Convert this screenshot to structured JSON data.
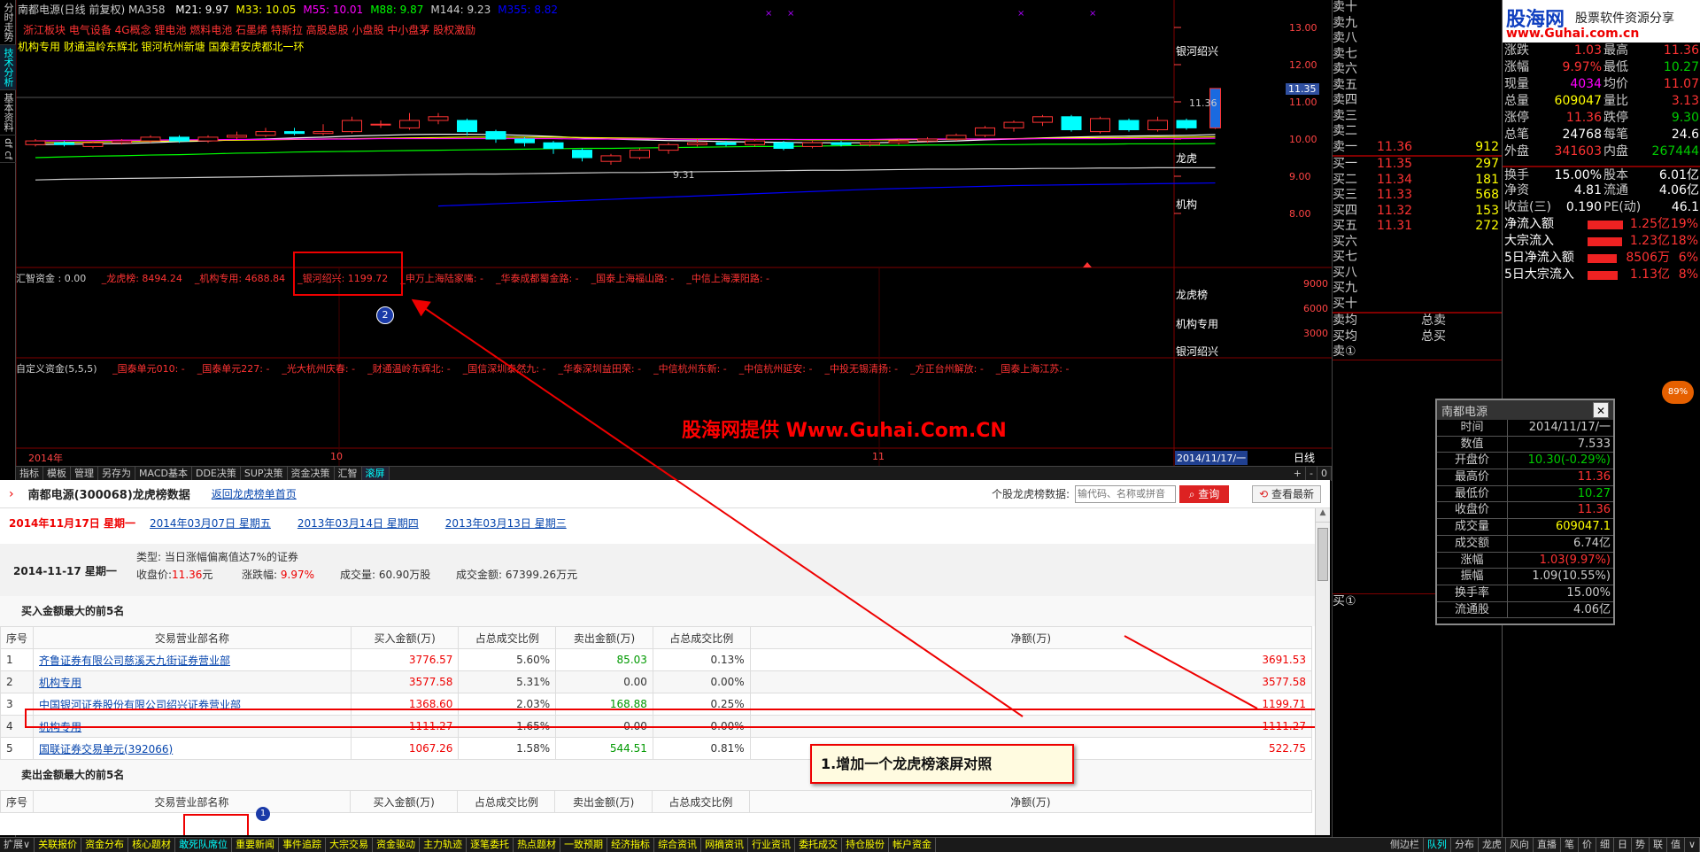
{
  "leftbar": {
    "items": [
      "分时走势",
      "技术分析",
      "基本资料",
      "df cf"
    ]
  },
  "chart": {
    "title": "南都电源(日线 前复权) MA358",
    "ma": [
      {
        "label": "M21: 9.97",
        "color": "#fff"
      },
      {
        "label": "M33: 10.05",
        "color": "#ff0"
      },
      {
        "label": "M55: 10.01",
        "color": "#f0f"
      },
      {
        "label": "M88: 9.87",
        "color": "#0f0"
      },
      {
        "label": "M144: 9.23",
        "color": "#ccc"
      },
      {
        "label": "M355: 8.82",
        "color": "#00f"
      }
    ],
    "concepts1": "浙江板块 电气设备 4G概念 锂电池 燃料电池 石墨烯 特斯拉 高股息股 小盘股 中小盘茅 股权激励",
    "concepts2": "机构专用 财通温岭东辉北 银河杭州新塘 国泰君安虎都北一环",
    "price_ticks": [
      "13.00",
      "12.00",
      "11.00",
      "10.00",
      "9.00",
      "8.00"
    ],
    "last_price": "11.35",
    "high_label": "11.36",
    "low_label": "9.31",
    "side_labels": [
      "银河绍兴",
      "龙虎",
      "机构"
    ],
    "fund_row": {
      "label": "汇智资金 : 0.00",
      "items": [
        "_龙虎榜: 8494.24",
        "_机构专用: 4688.84",
        "_银河绍兴: 1199.72",
        "_申万上海陆家嘴: -",
        "_华泰成都蜀金路: -",
        "_国泰上海福山路: -",
        "_中信上海溧阳路: -"
      ]
    },
    "fund_ticks": [
      "9000",
      "6000",
      "3000"
    ],
    "fund_side": [
      "龙虎榜",
      "机构专用",
      "银河绍兴"
    ],
    "custom_row": {
      "label": "自定义资金(5,5,5)",
      "items": [
        "_国泰单元010: -",
        "_国泰单元227: -",
        "_光大杭州庆春: -",
        "_财通温岭东辉北: -",
        "_国信深圳泰然九: -",
        "_华泰深圳益田荣: -",
        "_中信杭州东新: -",
        "_中信杭州延安: -",
        "_中投无锡清扬: -",
        "_方正台州解放: -",
        "_国泰上海江苏: -"
      ]
    },
    "x_labels": [
      "2014年",
      "10",
      "11"
    ],
    "date_box": "2014/11/17/一",
    "period": "日线",
    "badge2": "2",
    "watermark": "股海网提供 Www.Guhai.Com.CN"
  },
  "bottom_tabs": [
    "指标",
    "模板",
    "管理",
    "另存为",
    "MACD基本",
    "DDE决策",
    "SUP决策",
    "资金决策",
    "汇智",
    "滚屏"
  ],
  "bottom_right": [
    "+",
    "-",
    "0"
  ],
  "panel": {
    "title": "南都电源(300068)龙虎榜数据",
    "back_link": "返回龙虎榜单首页",
    "search_label": "个股龙虎榜数据:",
    "search_placeholder": "输代码、名称或拼音",
    "query_btn": "查询",
    "latest_btn": "查看最新",
    "dates": [
      {
        "t": "2014年11月17日  星期一",
        "active": true
      },
      {
        "t": "2014年03月07日  星期五",
        "active": false
      },
      {
        "t": "2013年03月14日  星期四",
        "active": false
      },
      {
        "t": "2013年03月13日  星期三",
        "active": false
      }
    ],
    "day": "2014-11-17  星期一",
    "type": "类型:  当日涨幅偏离值达7%的证券",
    "close_label": "收盘价:",
    "close_val": "11.36",
    "close_unit": "元",
    "chg_label": "涨跌幅:",
    "chg_val": "9.97%",
    "vol": "成交量:  60.90万股",
    "amt": "成交金额:  67399.26万元",
    "buy_title": "买入金额最大的前5名",
    "sell_title": "卖出金额最大的前5名",
    "headers": [
      "序号",
      "交易营业部名称",
      "买入金额(万)",
      "占总成交比例",
      "卖出金额(万)",
      "占总成交比例",
      "净额(万)"
    ],
    "rows": [
      [
        "1",
        "齐鲁证券有限公司慈溪天九街证券营业部",
        "3776.57",
        "5.60%",
        "85.03",
        "0.13%",
        "3691.53"
      ],
      [
        "2",
        "机构专用",
        "3577.58",
        "5.31%",
        "0.00",
        "0.00%",
        "3577.58"
      ],
      [
        "3",
        "中国银河证券股份有限公司绍兴证券营业部",
        "1368.60",
        "2.03%",
        "168.88",
        "0.25%",
        "1199.71"
      ],
      [
        "4",
        "机构专用",
        "1111.27",
        "1.65%",
        "0.00",
        "0.00%",
        "1111.27"
      ],
      [
        "5",
        "国联证券交易单元(392066)",
        "1067.26",
        "1.58%",
        "544.51",
        "0.81%",
        "522.75"
      ]
    ],
    "annotation": "1.增加一个龙虎榜滚屏对照",
    "badge1": "1"
  },
  "quote": {
    "sell": [
      {
        "l": "卖十"
      },
      {
        "l": "卖九"
      },
      {
        "l": "卖八"
      },
      {
        "l": "卖七"
      },
      {
        "l": "卖六"
      },
      {
        "l": "卖五"
      },
      {
        "l": "卖四"
      },
      {
        "l": "卖三"
      },
      {
        "l": "卖二"
      },
      {
        "l": "卖一",
        "p": "11.36",
        "v": "912"
      }
    ],
    "buy": [
      {
        "l": "买一",
        "p": "11.35",
        "v": "297"
      },
      {
        "l": "买二",
        "p": "11.34",
        "v": "181"
      },
      {
        "l": "买三",
        "p": "11.33",
        "v": "568"
      },
      {
        "l": "买四",
        "p": "11.32",
        "v": "153"
      },
      {
        "l": "买五",
        "p": "11.31",
        "v": "272"
      },
      {
        "l": "买六"
      },
      {
        "l": "买七"
      },
      {
        "l": "买八"
      },
      {
        "l": "买九"
      },
      {
        "l": "买十"
      }
    ],
    "ext": [
      {
        "a": "卖均",
        "b": "总卖"
      },
      {
        "a": "买均",
        "b": "总买"
      }
    ],
    "sell_circle": "卖①",
    "buy_circle": "买①"
  },
  "stats": {
    "brand": "股海网",
    "brand_sub": "股票软件资源分享",
    "brand_url": "www.Guhai.com.cn",
    "rows": [
      [
        {
          "t": "涨跌",
          "c": "#ccc"
        },
        {
          "t": "1.03",
          "c": "#f33"
        },
        {
          "t": "最高",
          "c": "#ccc"
        },
        {
          "t": "11.36",
          "c": "#f33"
        }
      ],
      [
        {
          "t": "涨幅",
          "c": "#ccc"
        },
        {
          "t": "9.97%",
          "c": "#f33"
        },
        {
          "t": "最低",
          "c": "#ccc"
        },
        {
          "t": "10.27",
          "c": "#0c0"
        }
      ],
      [
        {
          "t": "现量",
          "c": "#ccc"
        },
        {
          "t": "4034",
          "c": "#f0f"
        },
        {
          "t": "均价",
          "c": "#ccc"
        },
        {
          "t": "11.07",
          "c": "#f33"
        }
      ],
      [
        {
          "t": "总量",
          "c": "#ccc"
        },
        {
          "t": "609047",
          "c": "#ff0"
        },
        {
          "t": "量比",
          "c": "#ccc"
        },
        {
          "t": "3.13",
          "c": "#f33"
        }
      ],
      [
        {
          "t": "涨停",
          "c": "#ccc"
        },
        {
          "t": "11.36",
          "c": "#f33"
        },
        {
          "t": "跌停",
          "c": "#ccc"
        },
        {
          "t": "9.30",
          "c": "#0c0"
        }
      ],
      [
        {
          "t": "总笔",
          "c": "#ccc"
        },
        {
          "t": "24768",
          "c": "#fff"
        },
        {
          "t": "每笔",
          "c": "#ccc"
        },
        {
          "t": "24.6",
          "c": "#fff"
        }
      ],
      [
        {
          "t": "外盘",
          "c": "#ccc"
        },
        {
          "t": "341603",
          "c": "#f33"
        },
        {
          "t": "内盘",
          "c": "#ccc"
        },
        {
          "t": "267444",
          "c": "#0c0"
        }
      ],
      [
        {
          "t": "换手",
          "c": "#ccc"
        },
        {
          "t": "15.00%",
          "c": "#fff"
        },
        {
          "t": "股本",
          "c": "#ccc"
        },
        {
          "t": "6.01亿",
          "c": "#fff"
        }
      ],
      [
        {
          "t": "净资",
          "c": "#ccc"
        },
        {
          "t": "4.81",
          "c": "#fff"
        },
        {
          "t": "流通",
          "c": "#ccc"
        },
        {
          "t": "4.06亿",
          "c": "#fff"
        }
      ],
      [
        {
          "t": "收益(三)",
          "c": "#ccc"
        },
        {
          "t": "0.190",
          "c": "#fff"
        },
        {
          "t": "PE(动)",
          "c": "#ccc"
        },
        {
          "t": "46.1",
          "c": "#fff"
        }
      ]
    ],
    "flows": [
      {
        "l": "净流入额",
        "v": "1.25亿",
        "p": "19%",
        "f": 0.19
      },
      {
        "l": "大宗流入",
        "v": "1.23亿",
        "p": "18%",
        "f": 0.18
      },
      {
        "l": "5日净流入额",
        "v": "8506万",
        "p": "6%",
        "f": 0.06
      },
      {
        "l": "5日大宗流入",
        "v": "1.13亿",
        "p": "8%",
        "f": 0.08
      }
    ],
    "pct_badge": "89%"
  },
  "popup": {
    "title": "南都电源",
    "rows": [
      {
        "k": "时间",
        "v": "2014/11/17/一",
        "c": "#ccc"
      },
      {
        "k": "数值",
        "v": "7.533",
        "c": "#ccc"
      },
      {
        "k": "开盘价",
        "v": "10.30(-0.29%)",
        "c": "#0c0"
      },
      {
        "k": "最高价",
        "v": "11.36",
        "c": "#f33"
      },
      {
        "k": "最低价",
        "v": "10.27",
        "c": "#0c0"
      },
      {
        "k": "收盘价",
        "v": "11.36",
        "c": "#f33"
      },
      {
        "k": "成交量",
        "v": "609047.1",
        "c": "#ff0"
      },
      {
        "k": "成交额",
        "v": "6.74亿",
        "c": "#ccc"
      },
      {
        "k": "涨幅",
        "v": "1.03(9.97%)",
        "c": "#f33"
      },
      {
        "k": "振幅",
        "v": "1.09(10.55%)",
        "c": "#ccc"
      },
      {
        "k": "换手率",
        "v": "15.00%",
        "c": "#ccc"
      },
      {
        "k": "流通股",
        "v": "4.06亿",
        "c": "#ccc"
      }
    ]
  },
  "statusbar": {
    "left": [
      "扩展∨",
      "关联报价",
      "资金分布",
      "核心题材",
      "敢死队席位",
      "重要新闻",
      "事件追踪",
      "大宗交易",
      "资金驱动",
      "主力轨迹",
      "逐笔委托",
      "热点题材",
      "一致预期",
      "经济指标",
      "综合资讯",
      "网摘资讯",
      "行业资讯",
      "委托成交",
      "持仓股份",
      "帐户资金"
    ],
    "right": [
      "侧边栏",
      "队列",
      "分布",
      "龙虎",
      "风向",
      "直播",
      "笔",
      "价",
      "细",
      "日",
      "势",
      "联",
      "值",
      "∨"
    ]
  },
  "chart_data": {
    "type": "candlestick",
    "title": "南都电源(日线 前复权) MA358",
    "ylim": [
      7.5,
      13.5
    ],
    "candles": [
      {
        "o": 9.85,
        "c": 9.95,
        "h": 10.0,
        "l": 9.8
      },
      {
        "o": 9.9,
        "c": 9.85,
        "h": 9.95,
        "l": 9.8
      },
      {
        "o": 9.8,
        "c": 9.9,
        "h": 9.95,
        "l": 9.75
      },
      {
        "o": 9.9,
        "c": 9.95,
        "h": 10.0,
        "l": 9.85
      },
      {
        "o": 9.95,
        "c": 10.05,
        "h": 10.1,
        "l": 9.9
      },
      {
        "o": 10.05,
        "c": 9.95,
        "h": 10.1,
        "l": 9.9
      },
      {
        "o": 9.95,
        "c": 10.05,
        "h": 10.1,
        "l": 9.9
      },
      {
        "o": 10.05,
        "c": 10.1,
        "h": 10.2,
        "l": 10.0
      },
      {
        "o": 10.1,
        "c": 10.2,
        "h": 10.3,
        "l": 10.05
      },
      {
        "o": 10.2,
        "c": 10.15,
        "h": 10.3,
        "l": 10.1
      },
      {
        "o": 10.15,
        "c": 10.2,
        "h": 10.4,
        "l": 10.1
      },
      {
        "o": 10.2,
        "c": 10.5,
        "h": 10.6,
        "l": 10.15
      },
      {
        "o": 10.4,
        "c": 10.4,
        "h": 10.5,
        "l": 10.3
      },
      {
        "o": 10.3,
        "c": 10.5,
        "h": 10.7,
        "l": 10.25
      },
      {
        "o": 10.5,
        "c": 10.6,
        "h": 10.7,
        "l": 10.4
      },
      {
        "o": 10.5,
        "c": 10.2,
        "h": 10.55,
        "l": 10.1
      },
      {
        "o": 10.2,
        "c": 10.0,
        "h": 10.25,
        "l": 9.9
      },
      {
        "o": 10.0,
        "c": 9.9,
        "h": 10.05,
        "l": 9.8
      },
      {
        "o": 9.9,
        "c": 9.75,
        "h": 9.95,
        "l": 9.6
      },
      {
        "o": 9.7,
        "c": 9.5,
        "h": 9.75,
        "l": 9.4
      },
      {
        "o": 9.4,
        "c": 9.55,
        "h": 9.6,
        "l": 9.31
      },
      {
        "o": 9.5,
        "c": 9.7,
        "h": 9.75,
        "l": 9.45
      },
      {
        "o": 9.7,
        "c": 9.85,
        "h": 9.9,
        "l": 9.6
      },
      {
        "o": 9.85,
        "c": 9.9,
        "h": 10.0,
        "l": 9.8
      },
      {
        "o": 9.9,
        "c": 9.85,
        "h": 9.95,
        "l": 9.8
      },
      {
        "o": 9.85,
        "c": 9.95,
        "h": 10.0,
        "l": 9.8
      },
      {
        "o": 9.9,
        "c": 9.75,
        "h": 9.95,
        "l": 9.7
      },
      {
        "o": 9.8,
        "c": 9.9,
        "h": 9.95,
        "l": 9.75
      },
      {
        "o": 9.9,
        "c": 9.85,
        "h": 9.95,
        "l": 9.8
      },
      {
        "o": 9.85,
        "c": 9.9,
        "h": 9.95,
        "l": 9.8
      },
      {
        "o": 9.9,
        "c": 9.95,
        "h": 10.0,
        "l": 9.85
      },
      {
        "o": 9.95,
        "c": 10.0,
        "h": 10.05,
        "l": 9.9
      },
      {
        "o": 10.0,
        "c": 10.1,
        "h": 10.15,
        "l": 9.95
      },
      {
        "o": 10.1,
        "c": 10.3,
        "h": 10.35,
        "l": 10.05
      },
      {
        "o": 10.3,
        "c": 10.45,
        "h": 10.5,
        "l": 10.2
      },
      {
        "o": 10.45,
        "c": 10.6,
        "h": 10.65,
        "l": 10.35
      },
      {
        "o": 10.6,
        "c": 10.25,
        "h": 10.65,
        "l": 10.2
      },
      {
        "o": 10.2,
        "c": 10.55,
        "h": 10.6,
        "l": 10.15
      },
      {
        "o": 10.5,
        "c": 10.25,
        "h": 10.55,
        "l": 10.2
      },
      {
        "o": 10.25,
        "c": 10.5,
        "h": 10.6,
        "l": 10.2
      },
      {
        "o": 10.5,
        "c": 10.3,
        "h": 10.55,
        "l": 10.25
      },
      {
        "o": 10.3,
        "c": 11.36,
        "h": 11.36,
        "l": 10.27
      }
    ],
    "ma_lines": [
      {
        "name": "M21",
        "color": "#ffffff",
        "values": [
          9.85,
          9.86,
          9.87,
          9.88,
          9.9,
          9.93,
          9.95,
          9.98,
          10.0,
          10.03,
          10.05,
          10.08,
          10.1,
          10.12,
          10.13,
          10.13,
          10.12,
          10.1,
          10.07,
          10.03,
          10.0,
          9.98,
          9.96,
          9.95,
          9.93,
          9.92,
          9.91,
          9.9,
          9.9,
          9.9,
          9.91,
          9.93,
          9.95,
          9.98,
          10.0,
          10.03,
          10.05,
          10.07,
          10.08,
          10.09,
          10.1,
          10.12
        ]
      },
      {
        "name": "M33",
        "color": "#ffff00",
        "values": [
          9.9,
          9.91,
          9.92,
          9.93,
          9.94,
          9.95,
          9.96,
          9.97,
          9.98,
          9.99,
          10.0,
          10.01,
          10.02,
          10.03,
          10.04,
          10.05,
          10.05,
          10.05,
          10.05,
          10.04,
          10.03,
          10.02,
          10.01,
          10.0,
          10.0,
          9.99,
          9.99,
          9.98,
          9.98,
          9.98,
          9.98,
          9.99,
          10.0,
          10.0,
          10.01,
          10.02,
          10.03,
          10.04,
          10.04,
          10.05,
          10.05,
          10.06
        ]
      },
      {
        "name": "M55",
        "color": "#ff00ff",
        "values": [
          9.95,
          9.96,
          9.96,
          9.97,
          9.97,
          9.98,
          9.98,
          9.99,
          9.99,
          10.0,
          10.0,
          10.0,
          10.01,
          10.01,
          10.01,
          10.01,
          10.01,
          10.01,
          10.01,
          10.0,
          10.0,
          10.0,
          10.0,
          9.99,
          9.99,
          9.99,
          9.99,
          9.99,
          9.99,
          9.99,
          10.0,
          10.0,
          10.0,
          10.0,
          10.0,
          10.01,
          10.01,
          10.01,
          10.01,
          10.01,
          10.01,
          10.02
        ]
      },
      {
        "name": "M88",
        "color": "#00ff00",
        "values": [
          9.5,
          9.52,
          9.54,
          9.55,
          9.57,
          9.58,
          9.6,
          9.62,
          9.63,
          9.65,
          9.66,
          9.67,
          9.68,
          9.69,
          9.7,
          9.71,
          9.72,
          9.73,
          9.74,
          9.75,
          9.75,
          9.76,
          9.77,
          9.78,
          9.79,
          9.8,
          9.8,
          9.81,
          9.82,
          9.83,
          9.83,
          9.84,
          9.84,
          9.85,
          9.85,
          9.86,
          9.86,
          9.86,
          9.87,
          9.87,
          9.87,
          9.88
        ]
      },
      {
        "name": "M144",
        "color": "#cccccc",
        "values": [
          8.9,
          8.92,
          8.93,
          8.94,
          8.95,
          8.96,
          8.97,
          8.98,
          8.99,
          9.0,
          9.01,
          9.02,
          9.03,
          9.04,
          9.05,
          9.06,
          9.06,
          9.07,
          9.08,
          9.09,
          9.1,
          9.1,
          9.11,
          9.12,
          9.13,
          9.14,
          9.15,
          9.16,
          9.16,
          9.17,
          9.18,
          9.19,
          9.19,
          9.2,
          9.2,
          9.21,
          9.21,
          9.22,
          9.22,
          9.23,
          9.23,
          9.23
        ]
      },
      {
        "name": "M355",
        "color": "#0000ff",
        "values": [
          null,
          null,
          null,
          null,
          null,
          null,
          null,
          null,
          null,
          null,
          null,
          null,
          null,
          null,
          8.2,
          8.23,
          8.26,
          8.29,
          8.32,
          8.35,
          8.38,
          8.41,
          8.44,
          8.47,
          8.5,
          8.53,
          8.56,
          8.59,
          8.62,
          8.65,
          8.67,
          8.69,
          8.71,
          8.73,
          8.75,
          8.76,
          8.77,
          8.78,
          8.79,
          8.8,
          8.81,
          8.82
        ]
      }
    ]
  }
}
